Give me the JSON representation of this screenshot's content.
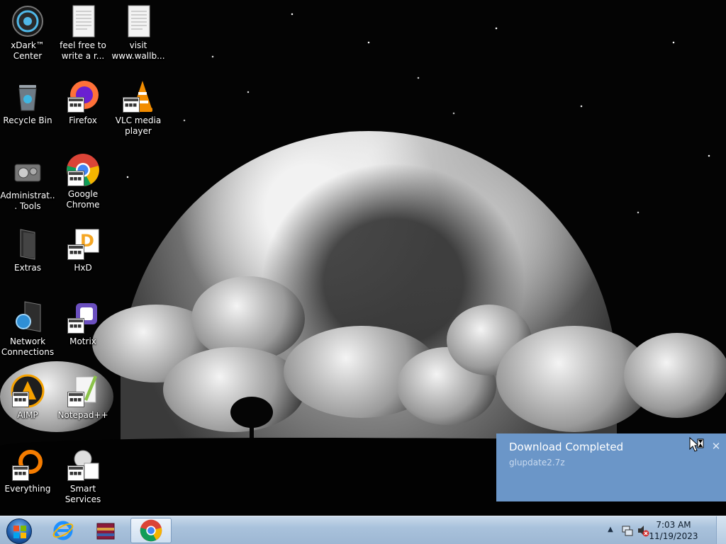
{
  "desktop": {
    "icons": [
      {
        "label": "xDark™ Center",
        "icon": "xdark-center-icon"
      },
      {
        "label": "feel free to write a r...",
        "icon": "text-document-icon"
      },
      {
        "label": "visit www.wallb...",
        "icon": "text-document-icon"
      },
      {
        "label": "Recycle Bin",
        "icon": "recycle-bin-icon"
      },
      {
        "label": "Firefox",
        "icon": "firefox-icon"
      },
      {
        "label": "VLC media player",
        "icon": "vlc-icon"
      },
      {
        "label": "Administrat... Tools",
        "icon": "admin-tools-icon"
      },
      {
        "label": "Google Chrome",
        "icon": "chrome-icon"
      },
      {
        "label": "Extras",
        "icon": "folder-icon"
      },
      {
        "label": "HxD",
        "icon": "hxd-icon"
      },
      {
        "label": "Network Connections",
        "icon": "network-connections-icon"
      },
      {
        "label": "Motrix",
        "icon": "motrix-icon"
      },
      {
        "label": "AIMP",
        "icon": "aimp-icon"
      },
      {
        "label": "Notepad++",
        "icon": "notepadpp-icon"
      },
      {
        "label": "Everything",
        "icon": "everything-icon"
      },
      {
        "label": "Smart Services",
        "icon": "smart-services-icon"
      }
    ]
  },
  "notification": {
    "title": "Download Completed",
    "filename": "glupdate2.7z",
    "close": "✕",
    "background": "#6b96c8"
  },
  "taskbar": {
    "pinned": [
      {
        "name": "internet-explorer",
        "icon": "ie-icon"
      },
      {
        "name": "winrar",
        "icon": "winrar-icon"
      },
      {
        "name": "chrome",
        "icon": "chrome-icon"
      }
    ],
    "tray": {
      "overflow": "▲",
      "time": "7:03 AM",
      "date": "11/19/2023"
    }
  }
}
